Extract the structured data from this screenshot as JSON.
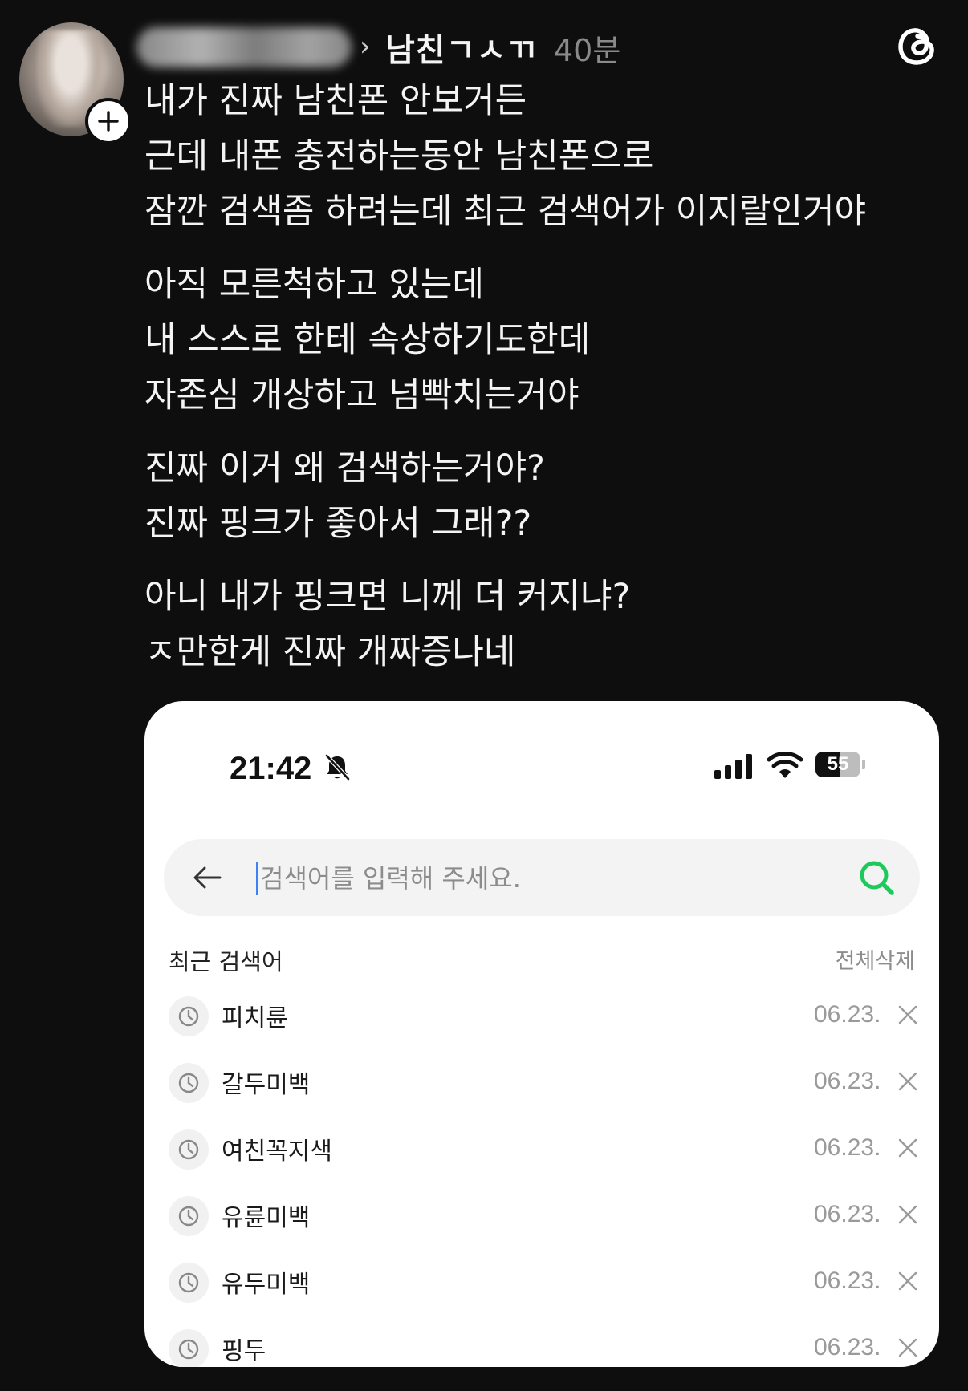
{
  "post": {
    "topic": "남친ㄱㅅㄲ",
    "time": "40분",
    "paragraphs": [
      [
        "내가 진짜 남친폰 안보거든",
        "근데 내폰 충전하는동안 남친폰으로",
        "잠깐 검색좀 하려는데 최근 검색어가 이지랄인거야"
      ],
      [
        "아직 모른척하고 있는데",
        "내 스스로 한테 속상하기도한데",
        "자존심 개상하고 넘빡치는거야"
      ],
      [
        "진짜 이거 왜 검색하는거야?",
        "진짜 핑크가 좋아서 그래??"
      ],
      [
        "아니 내가 핑크면 니께 더 커지냐?",
        "ㅈ만한게 진짜 개짜증나네"
      ]
    ]
  },
  "screenshot": {
    "status": {
      "time": "21:42",
      "battery": "55"
    },
    "search": {
      "placeholder": "검색어를 입력해 주세요.",
      "accent": "#1ec95b"
    },
    "recent": {
      "title": "최근 검색어",
      "clear_all": "전체삭제",
      "items": [
        {
          "term": "피치륜",
          "date": "06.23."
        },
        {
          "term": "갈두미백",
          "date": "06.23."
        },
        {
          "term": "여친꼭지색",
          "date": "06.23."
        },
        {
          "term": "유륜미백",
          "date": "06.23."
        },
        {
          "term": "유두미백",
          "date": "06.23."
        },
        {
          "term": "핑두",
          "date": "06.23."
        }
      ]
    }
  },
  "icons": {
    "follow": "plus-icon",
    "app": "threads-logo-icon",
    "back": "back-arrow-icon",
    "search": "search-icon",
    "history": "clock-icon",
    "delete": "close-icon",
    "bell": "bell-off-icon",
    "signal": "signal-icon",
    "wifi": "wifi-icon",
    "battery": "battery-icon"
  }
}
